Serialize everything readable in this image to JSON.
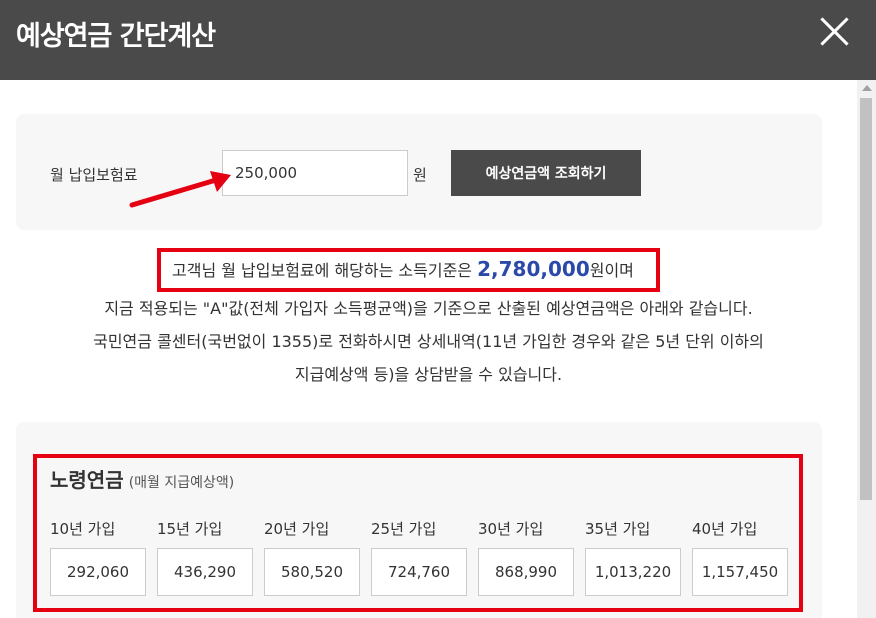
{
  "dialog": {
    "title": "예상연금 간단계산"
  },
  "form": {
    "label": "월 납입보험료",
    "value": "250,000",
    "unit": "원",
    "button": "예상연금액 조회하기"
  },
  "result": {
    "prefix": "고객님 월 납입보험료에 해당하는 소득기준은 ",
    "amount": "2,780,000",
    "suffix": "원이며",
    "line2": "지금 적용되는 \"A\"값(전체 가입자 소득평균액)을 기준으로 산출된 예상연금액은 아래와 같습니다.",
    "line3": "국민연금 콜센터(국번없이 1355)로 전화하시면 상세내역(11년 가입한 경우와 같은 5년 단위 이하의",
    "line4": "지급예상액 등)을 상담받을 수 있습니다."
  },
  "pension": {
    "title": "노령연금",
    "subtitle": "(매월 지급예상액)",
    "years": [
      {
        "label": "10년 가입",
        "value": "292,060"
      },
      {
        "label": "15년 가입",
        "value": "436,290"
      },
      {
        "label": "20년 가입",
        "value": "580,520"
      },
      {
        "label": "25년 가입",
        "value": "724,760"
      },
      {
        "label": "30년 가입",
        "value": "868,990"
      },
      {
        "label": "35년 가입",
        "value": "1,013,220"
      },
      {
        "label": "40년 가입",
        "value": "1,157,450"
      }
    ]
  },
  "colors": {
    "header": "#4a4a4a",
    "highlight": "#e50012",
    "amount": "#2b4aa8"
  }
}
